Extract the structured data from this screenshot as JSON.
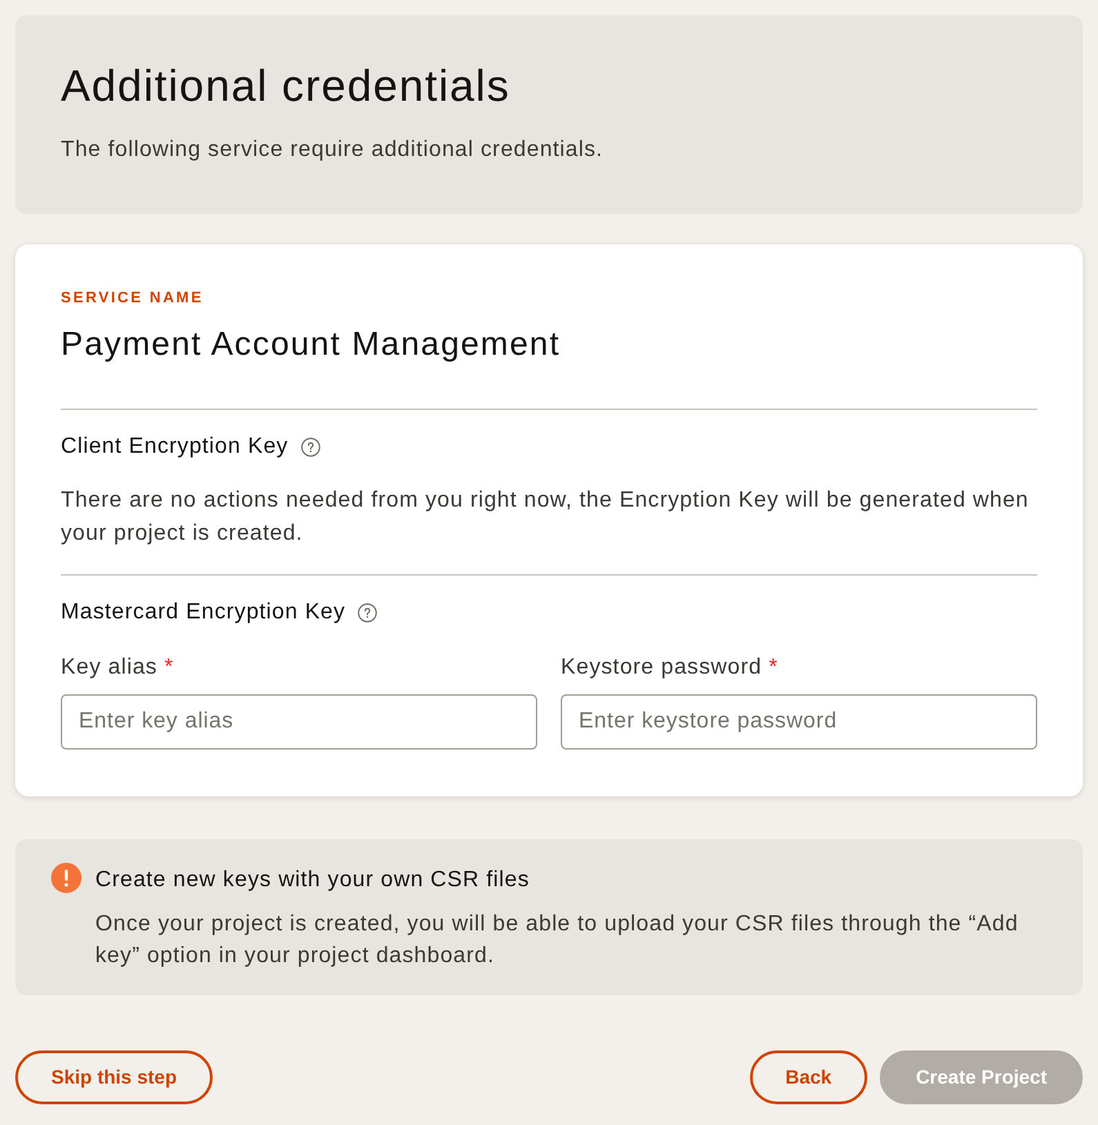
{
  "header": {
    "title": "Additional credentials",
    "subtitle": "The following service require additional credentials."
  },
  "service": {
    "eyebrow": "SERVICE NAME",
    "name": "Payment Account Management",
    "sections": [
      {
        "kind": "info",
        "title": "Client Encryption Key",
        "text": "There are no actions needed from you right now, the Encryption Key will be generated when your project is created."
      },
      {
        "kind": "fields",
        "title": "Mastercard Encryption Key",
        "fields": [
          {
            "label": "Key alias",
            "required_mark": "*",
            "placeholder": "Enter key alias"
          },
          {
            "label": "Keystore password",
            "required_mark": "*",
            "placeholder": "Enter keystore password"
          }
        ]
      }
    ]
  },
  "notice": {
    "title": "Create new keys with your own CSR files",
    "text": "Once your project is created, you will be able to upload your CSR files through the “Add key” option in your project dashboard."
  },
  "footer": {
    "left_buttons": [
      {
        "label": "Skip this step",
        "disabled": false
      }
    ],
    "right_buttons": [
      {
        "label": "Back",
        "disabled": false
      },
      {
        "label": "Create Project",
        "disabled": true
      }
    ]
  }
}
